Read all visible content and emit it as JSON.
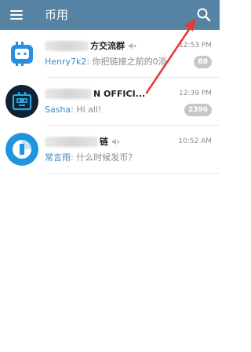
{
  "header": {
    "title": "币用",
    "menu_icon": "hamburger-menu-icon",
    "search_icon": "search-icon",
    "background": "#5682a3"
  },
  "chats": [
    {
      "name": "方交流群",
      "time": "12:53 PM",
      "sender": "Henry7k2:",
      "preview": " 你把链接之前的0添",
      "badge": "88",
      "muted": true,
      "avatar_icon": "bitcoin-chat-logo-icon"
    },
    {
      "name": "N OFFICI...",
      "time": "12:39 PM",
      "sender": "Sasha:",
      "preview": " Hi all!",
      "badge": "2396",
      "muted": false,
      "avatar_icon": "blue-robot-logo-icon"
    },
    {
      "name": "链",
      "time": "10:52 AM",
      "sender": "常言雨:",
      "preview": " 什么时候发币？",
      "badge": "",
      "muted": true,
      "avatar_icon": "blue-circle-logo-icon"
    }
  ],
  "colors": {
    "accent_sender": "#3d8cc7",
    "badge_muted": "#c7c7c7",
    "annotation_arrow": "#e53935"
  }
}
